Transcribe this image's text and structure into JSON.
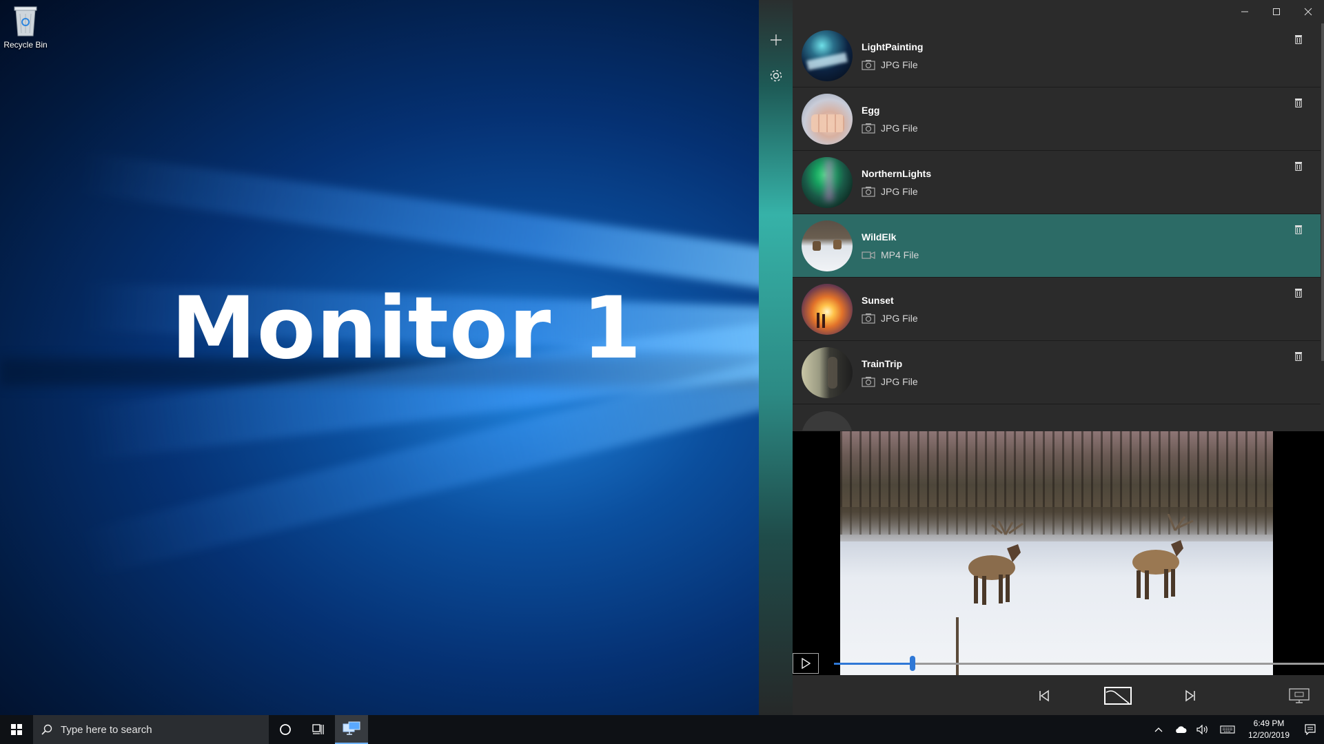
{
  "desktop": {
    "monitor_label": "Monitor 1",
    "recycle_bin_label": "Recycle Bin"
  },
  "app": {
    "rail": {
      "add_icon": "plus-icon",
      "settings_icon": "gear-icon"
    },
    "window_controls": [
      "minimize-icon",
      "maximize-icon",
      "close-icon"
    ],
    "items": [
      {
        "name": "LightPainting",
        "type": "JPG File",
        "kind": "photo",
        "selected": false
      },
      {
        "name": "Egg",
        "type": "JPG File",
        "kind": "photo",
        "selected": false
      },
      {
        "name": "NorthernLights",
        "type": "JPG File",
        "kind": "photo",
        "selected": false
      },
      {
        "name": "WildElk",
        "type": "MP4 File",
        "kind": "video",
        "selected": true
      },
      {
        "name": "Sunset",
        "type": "JPG File",
        "kind": "photo",
        "selected": false
      },
      {
        "name": "TrainTrip",
        "type": "JPG File",
        "kind": "photo",
        "selected": false
      }
    ],
    "player": {
      "progress": 0.16,
      "selected_color": "#2c6b66",
      "accent": "#2f78d6"
    }
  },
  "taskbar": {
    "search_placeholder": "Type here to search",
    "time": "6:49 PM",
    "date": "12/20/2019"
  }
}
